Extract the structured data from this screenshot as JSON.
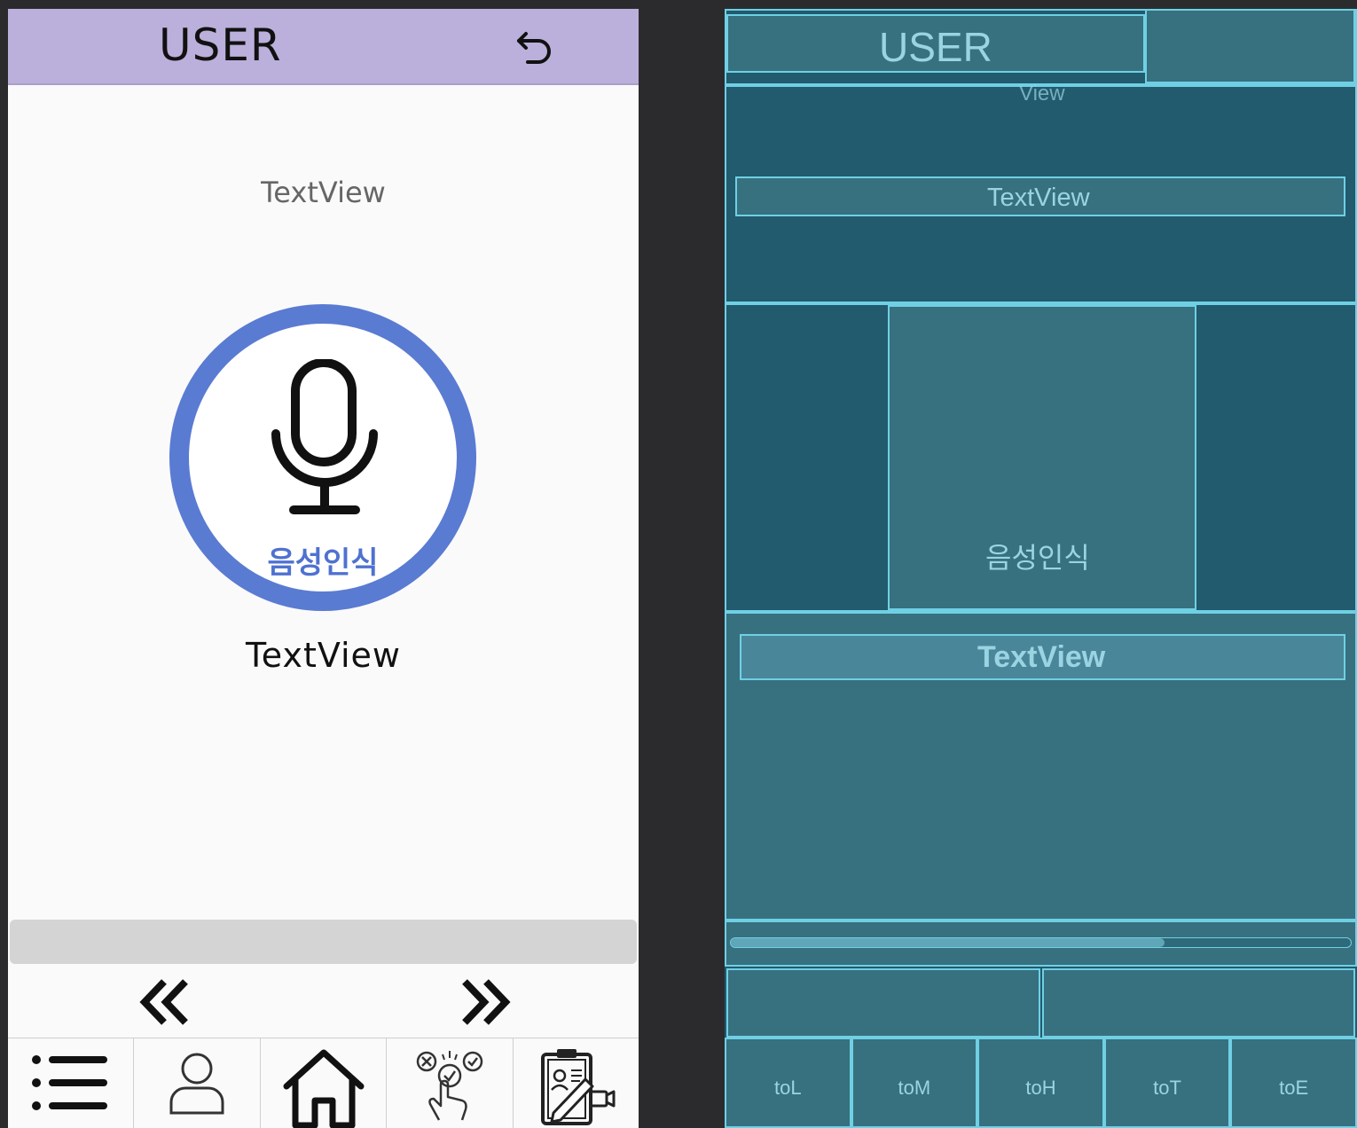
{
  "design": {
    "header": {
      "title": "USER",
      "back_icon": "undo-arrow-icon"
    },
    "top_textview": "TextView",
    "mic_button": {
      "icon": "microphone-icon",
      "label": "음성인식",
      "accent": "#5a7bd2"
    },
    "result_textview": "TextView",
    "progress": {
      "value": 0
    },
    "pager": {
      "prev_icon": "double-chevron-left-icon",
      "next_icon": "double-chevron-right-icon"
    },
    "bottom_nav": [
      {
        "icon": "list-icon"
      },
      {
        "icon": "user-icon"
      },
      {
        "icon": "home-icon"
      },
      {
        "icon": "touch-check-icon"
      },
      {
        "icon": "clipboard-video-icon"
      }
    ],
    "header_color": "#bbb0dc"
  },
  "blueprint": {
    "header_title": "USER",
    "view_label": "View",
    "top_textview": "TextView",
    "mic_label": "음성인식",
    "result_textview": "TextView",
    "progress": {
      "value": 0.7
    },
    "nav_labels": [
      "toL",
      "toM",
      "toH",
      "toT",
      "toE"
    ],
    "background": "#225a6e",
    "outline": "#6fd0e4"
  }
}
